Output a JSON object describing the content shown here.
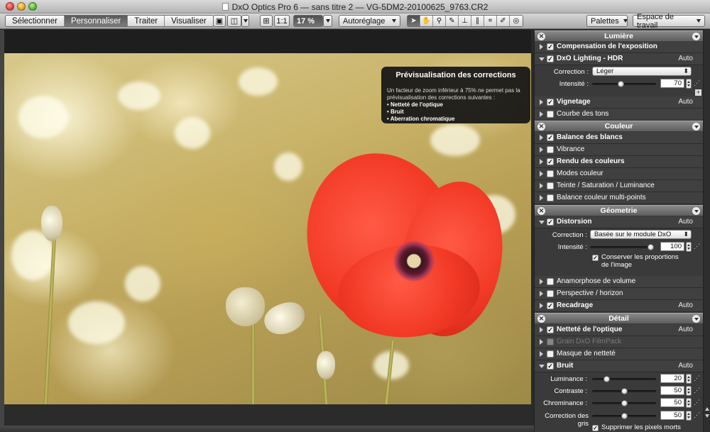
{
  "window": {
    "title": "DxO Optics Pro 6 — sans titre 2 — VG-5DM2-20100625_9763.CR2"
  },
  "toolbar": {
    "tabs": [
      "Sélectionner",
      "Personnaliser",
      "Traiter",
      "Visualiser"
    ],
    "active_tab": "Personnaliser",
    "zoom_1to1": "1:1",
    "zoom_value": "17 %",
    "preset": "Autoréglage",
    "palettes": "Palettes",
    "workspace": "Espace de travail"
  },
  "tooltip": {
    "title": "Prévisualisation des corrections",
    "body": "Un facteur de zoom inférieur à 75% ne permet pas la prévisualisation des corrections suivantes :",
    "items": [
      "Netteté de l'optique",
      "Bruit",
      "Aberration chromatique"
    ]
  },
  "palette": {
    "lumiere": {
      "title": "Lumière",
      "exposure": "Compensation de l'exposition",
      "lighting": "DxO Lighting - HDR",
      "lighting_auto": "Auto",
      "correction_label": "Correction :",
      "correction_value": "Léger",
      "intensite_label": "Intensité :",
      "intensite_value": "70",
      "intensite_fraction": 0.45,
      "vignetage": "Vignetage",
      "vignetage_auto": "Auto",
      "courbe": "Courbe des tons"
    },
    "couleur": {
      "title": "Couleur",
      "balance": "Balance des blancs",
      "vibrance": "Vibrance",
      "rendu": "Rendu des couleurs",
      "modes": "Modes couleur",
      "teinte": "Teinte / Saturation / Luminance",
      "balance_multi": "Balance couleur multi-points"
    },
    "geometrie": {
      "title": "Géometrie",
      "distorsion": "Distorsion",
      "distorsion_auto": "Auto",
      "correction_label": "Correction :",
      "correction_value": "Basée sur le module DxO",
      "intensite_label": "Intensité :",
      "intensite_value": "100",
      "intensite_fraction": 1.0,
      "conserver": "Conserver les proportions de l'image",
      "anamorphose": "Anamorphose de volume",
      "perspective": "Perspective / horizon",
      "recadrage": "Recadrage",
      "recadrage_auto": "Auto"
    },
    "detail": {
      "title": "Détail",
      "nettete": "Netteté de l'optique",
      "nettete_auto": "Auto",
      "grain": "Grain DxO FilmPack",
      "masque": "Masque de netteté",
      "bruit": "Bruit",
      "bruit_auto": "Auto",
      "luminance_label": "Luminance :",
      "luminance_value": "20",
      "luminance_fraction": 0.2,
      "contraste_label": "Contraste :",
      "contraste_value": "50",
      "contraste_fraction": 0.5,
      "chrominance_label": "Chrominance :",
      "chrominance_value": "50",
      "chrominance_fraction": 0.5,
      "correction_gris_label": "Correction des gris",
      "correction_gris_value": "50",
      "correction_gris_fraction": 0.5,
      "pixels_morts": "Supprimer les pixels morts"
    }
  }
}
